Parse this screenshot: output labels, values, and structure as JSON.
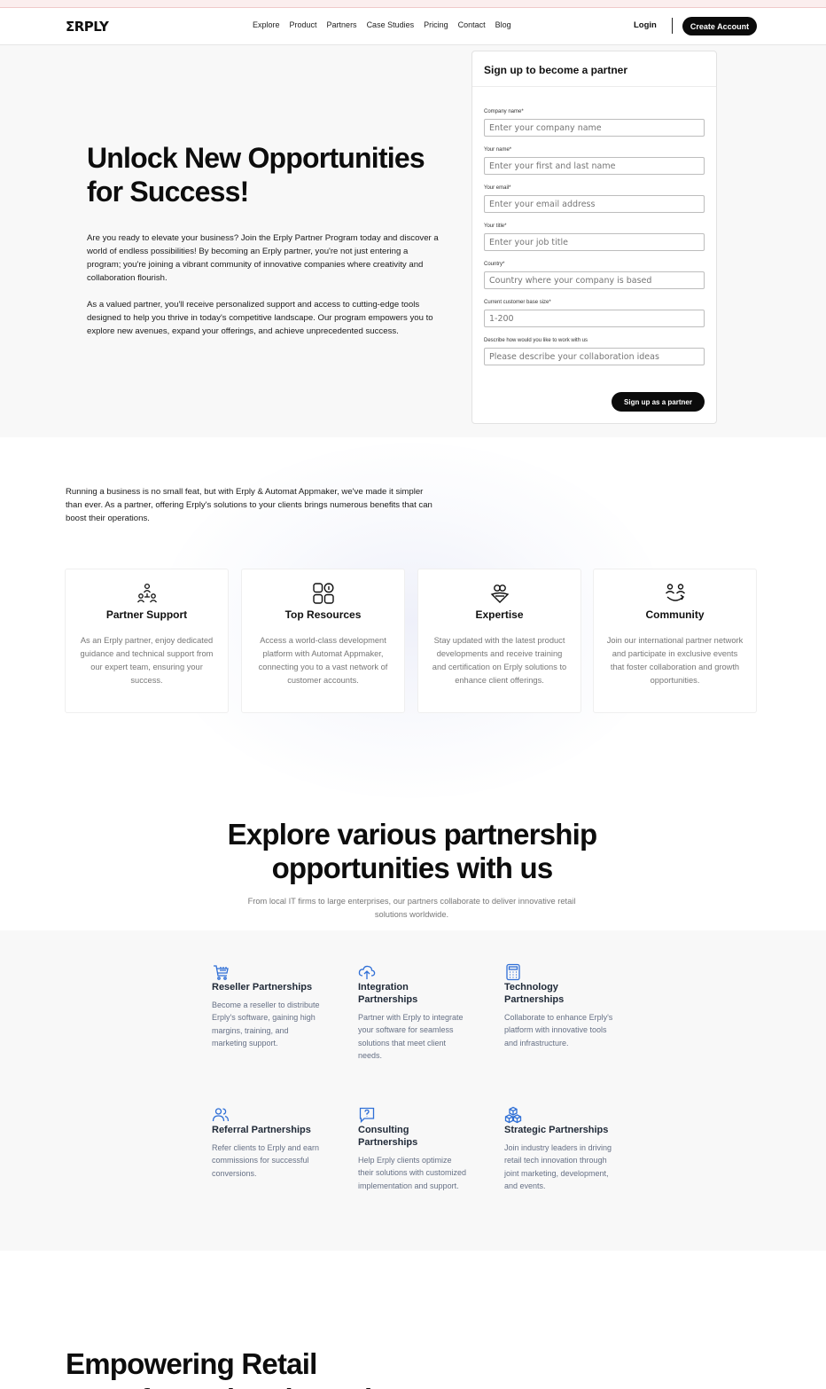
{
  "nav": {
    "logo": "ΣRPLY",
    "links": [
      "Explore",
      "Product",
      "Partners",
      "Case Studies",
      "Pricing",
      "Contact",
      "Blog"
    ],
    "login": "Login",
    "create_account": "Create Account"
  },
  "hero": {
    "title": "Unlock New Opportunities for Success!",
    "paragraph1": "Are you ready to elevate your business? Join the Erply Partner Program today and discover a world of endless possibilities! By becoming an Erply partner, you're not just entering a program; you're joining a vibrant community of innovative companies where creativity and collaboration flourish.",
    "paragraph2": "As a valued partner, you'll receive personalized support and access to cutting-edge tools designed to help you thrive in today's competitive landscape. Our program empowers you to explore new avenues, expand your offerings, and achieve unprecedented success."
  },
  "form": {
    "title": "Sign up to become a partner",
    "fields": [
      {
        "label": "Company name*",
        "placeholder": "Enter your company name"
      },
      {
        "label": "Your name*",
        "placeholder": "Enter your first and last name"
      },
      {
        "label": "Your email*",
        "placeholder": "Enter your email address"
      },
      {
        "label": "Your title*",
        "placeholder": "Enter your job title"
      },
      {
        "label": "Country*",
        "placeholder": "Country where your company is based"
      },
      {
        "label": "Current customer base size*",
        "placeholder": "1-200"
      },
      {
        "label": "Describe how would you like to work with us",
        "placeholder": "Please describe your collaboration ideas"
      }
    ],
    "submit": "Sign up as a partner"
  },
  "intro": "Running a business is no small feat, but with Erply & Automat Appmaker, we've made it simpler than ever. As a partner, offering Erply's solutions to your clients brings numerous benefits that can boost their operations.",
  "features": [
    {
      "icon": "partner-support-icon",
      "title": "Partner Support",
      "desc": "As an Erply partner, enjoy dedicated guidance and technical support from our expert team, ensuring your success."
    },
    {
      "icon": "resources-icon",
      "title": "Top Resources",
      "desc": "Access a world-class development platform with Automat Appmaker, connecting you to a vast network of customer accounts."
    },
    {
      "icon": "expertise-icon",
      "title": "Expertise",
      "desc": "Stay updated with the latest product developments and receive training and certification on Erply solutions to enhance client offerings."
    },
    {
      "icon": "community-icon",
      "title": "Community",
      "desc": "Join our international partner network and participate in exclusive events that foster collaboration and growth opportunities."
    }
  ],
  "explore": {
    "title": "Explore various partnership opportunities with us",
    "subtitle": "From local IT firms to large enterprises, our partners collaborate to deliver innovative retail solutions worldwide."
  },
  "partnerships": [
    {
      "icon": "cart-icon",
      "title": "Reseller Partnerships",
      "desc": "Become a reseller to distribute Erply's software, gaining high margins, training, and marketing support."
    },
    {
      "icon": "cloud-upload-icon",
      "title": "Integration Partnerships",
      "desc": "Partner with Erply to integrate your software for seamless solutions that meet client needs."
    },
    {
      "icon": "calculator-icon",
      "title": "Technology Partnerships",
      "desc": "Collaborate to enhance Erply's platform with innovative tools and infrastructure."
    },
    {
      "icon": "users-icon",
      "title": "Referral Partnerships",
      "desc": "Refer clients to Erply and earn commissions for successful conversions."
    },
    {
      "icon": "question-chat-icon",
      "title": "Consulting Partnerships",
      "desc": "Help Erply clients optimize their solutions with customized implementation and support."
    },
    {
      "icon": "cubes-icon",
      "title": "Strategic Partnerships",
      "desc": "Join industry leaders in driving retail tech innovation through joint marketing, development, and events."
    }
  ],
  "bottom": {
    "title": "Empowering Retail Transformation through"
  },
  "colors": {
    "accent_blue": "#2f6fd6",
    "button_black": "#0b0b0b",
    "hero_bg": "#f8f8f8"
  }
}
